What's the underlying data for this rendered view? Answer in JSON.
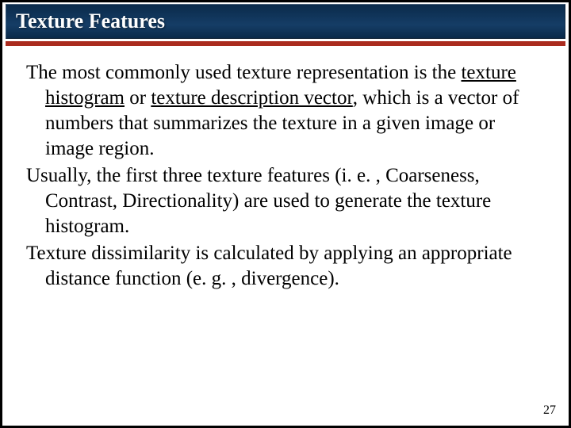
{
  "slide": {
    "title": "Texture Features",
    "para1_lead": "The most commonly used texture representation is the ",
    "term1": "texture histogram",
    "para1_mid": " or ",
    "term2": "texture description vector",
    "para1_tail": ", which is a vector of numbers that summarizes the texture in a given image or image region.",
    "para2": "Usually, the first three texture features (i. e. , Coarseness, Contrast, Directionality) are used to generate the texture histogram.",
    "para3": "Texture dissimilarity is calculated by applying an appropriate distance function (e. g. , divergence).",
    "page_number": "27"
  }
}
